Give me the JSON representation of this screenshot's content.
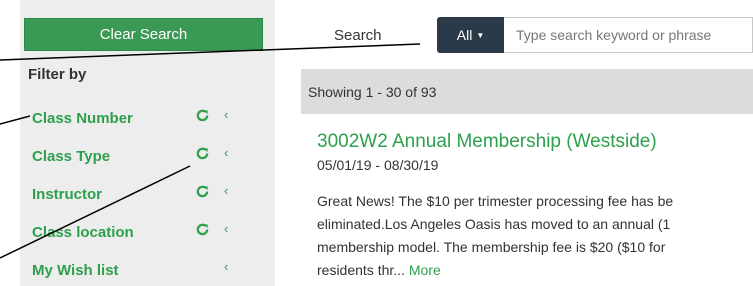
{
  "sidebar": {
    "clear_search_label": "Clear Search",
    "filter_title": "Filter by",
    "filters": [
      {
        "label": "Class Number",
        "has_refresh": true
      },
      {
        "label": "Class Type",
        "has_refresh": true
      },
      {
        "label": "Instructor",
        "has_refresh": true
      },
      {
        "label": "Class location",
        "has_refresh": true
      },
      {
        "label": "My Wish list",
        "has_refresh": false
      }
    ]
  },
  "search": {
    "label": "Search",
    "scope_label": "All",
    "placeholder": "Type search keyword or phrase"
  },
  "results": {
    "summary": "Showing 1 - 30 of 93",
    "items": [
      {
        "title": "3002W2 Annual Membership (Westside)",
        "dates": "05/01/19 - 08/30/19",
        "description_lines": [
          "Great News! The $10 per trimester processing fee has be",
          "eliminated.Los Angeles Oasis has moved to an annual (1",
          "membership model. The membership fee is $20 ($10 for",
          "residents thr..."
        ],
        "more_label": "More"
      }
    ]
  },
  "icons": {
    "refresh": "refresh-icon",
    "chevron": "chevron-left-icon",
    "caret": "caret-down-icon"
  },
  "colors": {
    "accent_green": "#3a9a55",
    "link_green": "#2e9f4c",
    "dark_button": "#2b3a48",
    "sidebar_bg": "#ededed",
    "results_bar_bg": "#dcdcdc"
  }
}
